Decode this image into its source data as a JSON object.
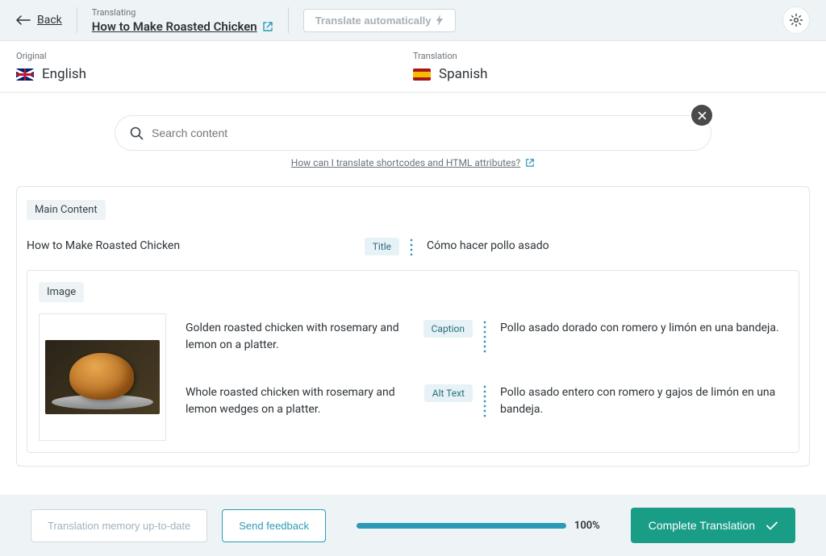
{
  "header": {
    "back_label": "Back",
    "translating_label": "Translating",
    "translating_title": "How to Make Roasted Chicken",
    "translate_auto_label": "Translate automatically"
  },
  "langs": {
    "original_label": "Original",
    "original_name": "English",
    "translation_label": "Translation",
    "translation_name": "Spanish"
  },
  "search": {
    "placeholder": "Search content",
    "help_link": "How can I translate shortcodes and HTML attributes?"
  },
  "content": {
    "main_label": "Main Content",
    "title": {
      "source": "How to Make Roasted Chicken",
      "tag": "Title",
      "target": "Cómo hacer pollo asado"
    },
    "image_label": "Image",
    "caption": {
      "source": "Golden roasted chicken with rosemary and lemon on a platter.",
      "tag": "Caption",
      "target": "Pollo asado dorado con romero y limón en una bandeja."
    },
    "alt": {
      "source": "Whole roasted chicken with rosemary and lemon wedges on a platter.",
      "tag": "Alt Text",
      "target": "Pollo asado entero con romero y gajos de limón en una bandeja."
    }
  },
  "footer": {
    "memory_label": "Translation memory up-to-date",
    "feedback_label": "Send feedback",
    "progress_pct": "100%",
    "complete_label": "Complete Translation"
  }
}
